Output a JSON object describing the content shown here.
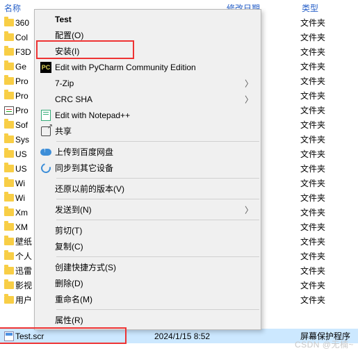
{
  "header": {
    "name": "名称",
    "date": "修改日期",
    "type": "类型"
  },
  "folder_type": "文件夹",
  "folders": [
    "360",
    "Col",
    "F3D",
    "Ge",
    "Pro",
    "Pro",
    "Pro",
    "Sof",
    "Sys",
    "US",
    "US",
    "Wi",
    "Wi",
    "Xm",
    "XM",
    "壁纸",
    "个人",
    "迅雷",
    "影视",
    "用户"
  ],
  "selected_file": {
    "name": "Test.scr",
    "date": "2024/1/15 8:52",
    "type": "屏幕保护程序"
  },
  "menu": {
    "test": "Test",
    "configure": "配置(O)",
    "install": "安装(I)",
    "pycharm": "Edit with PyCharm Community Edition",
    "sevenzip": "7-Zip",
    "crcsha": "CRC SHA",
    "notepadpp": "Edit with Notepad++",
    "share": "共享",
    "baidu_upload": "上传到百度网盘",
    "baidu_sync": "同步到其它设备",
    "restore": "还原以前的版本(V)",
    "sendto": "发送到(N)",
    "cut": "剪切(T)",
    "copy": "复制(C)",
    "shortcut": "创建快捷方式(S)",
    "delete": "删除(D)",
    "rename": "重命名(M)",
    "properties": "属性(R)"
  },
  "watermark": "CSDN @无楠~"
}
